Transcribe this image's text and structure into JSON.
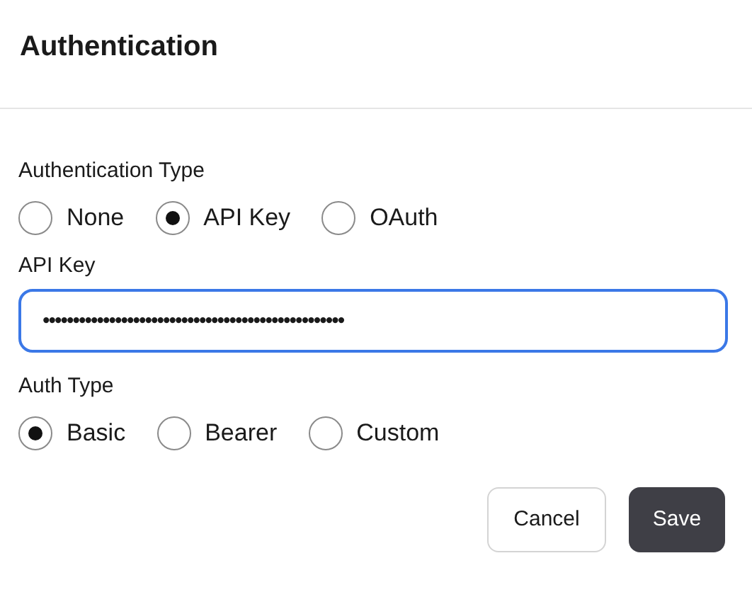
{
  "dialog": {
    "title": "Authentication"
  },
  "auth_type": {
    "label": "Authentication Type",
    "options": [
      {
        "label": "None",
        "selected": false
      },
      {
        "label": "API Key",
        "selected": true
      },
      {
        "label": "OAuth",
        "selected": false
      }
    ]
  },
  "api_key": {
    "label": "API Key",
    "value": "••••••••••••••••••••••••••••••••••••••••••••••••••",
    "focused": true
  },
  "auth_scheme": {
    "label": "Auth Type",
    "options": [
      {
        "label": "Basic",
        "selected": true
      },
      {
        "label": "Bearer",
        "selected": false
      },
      {
        "label": "Custom",
        "selected": false
      }
    ]
  },
  "buttons": [
    {
      "label": "Cancel",
      "kind": "secondary"
    },
    {
      "label": "Save",
      "kind": "primary"
    }
  ]
}
